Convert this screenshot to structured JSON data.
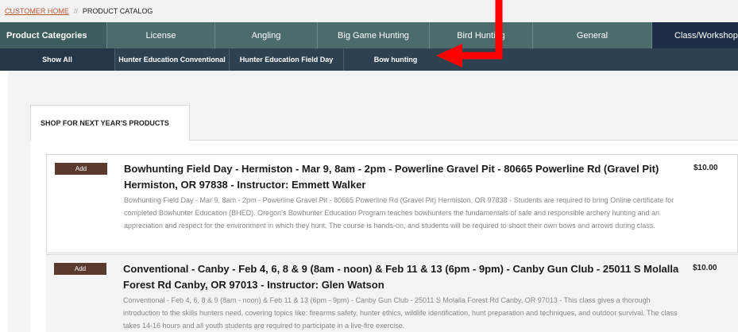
{
  "breadcrumb": {
    "home": "CUSTOMER HOME",
    "separator": "//",
    "current": "PRODUCT CATALOG"
  },
  "categories": [
    {
      "label": "Product Categories"
    },
    {
      "label": "License"
    },
    {
      "label": "Angling"
    },
    {
      "label": "Big Game Hunting"
    },
    {
      "label": "Bird Hunting"
    },
    {
      "label": "General"
    },
    {
      "label": "Class/Workshop"
    }
  ],
  "subcategories": [
    {
      "label": "Show All"
    },
    {
      "label": "Hunter Education Conventional"
    },
    {
      "label": "Hunter Education Field Day"
    },
    {
      "label": "Bow hunting"
    }
  ],
  "tab": {
    "label": "SHOP FOR NEXT YEAR'S PRODUCTS"
  },
  "products": [
    {
      "add_label": "Add",
      "title": "Bowhunting Field Day - Hermiston - Mar 9, 8am - 2pm - Powerline Gravel Pit - 80665 Powerline Rd (Gravel Pit) Hermiston, OR 97838 - Instructor: Emmett Walker",
      "description": "Bowhunting Field Day - Mar 9, 8am - 2pm - Powerline Gravel Pit - 80665 Powerline Rd (Gravel Pit) Hermiston, OR 97838 - Students are required to bring Online certificate for completed Bowhunter Education (BHED). Oregon's Bowhunter Education Program teaches bowhunters the fundamentals of safe and responsible archery hunting and an appreciation and respect for the environment in which they hunt. The course is hands-on, and students will be required to shoot their own bows and arrows during class.",
      "price": "$10.00"
    },
    {
      "add_label": "Add",
      "title": "Conventional - Canby - Feb 4, 6, 8 & 9 (8am - noon) & Feb 11 & 13 (6pm - 9pm) - Canby Gun Club - 25011 S Molalla Forest Rd Canby, OR 97013 - Instructor: Glen Watson",
      "description": "Conventional - Feb 4, 6, 8 & 9 (8am - noon) & Feb 11 & 13 (6pm - 9pm) - Canby Gun Club - 25011 S Molalla Forest Rd Canby, OR 97013 - This class gives a thorough introduction to the skills hunters need, covering topics like: firearms safety, hunter ethics, wildlife identification, hunt preparation and techniques, and outdoor survival. The class takes 14-16 hours and all youth students are required to participate in a live-fire exercise.",
      "price": "$10.00"
    }
  ],
  "colors": {
    "category_bar": "#4c6c6c",
    "subcategory_bar": "#2e4150",
    "add_button": "#5b3a2e",
    "annotation_arrow": "#ff0000"
  },
  "icons": {
    "annotation": "red-arrow-icon"
  }
}
